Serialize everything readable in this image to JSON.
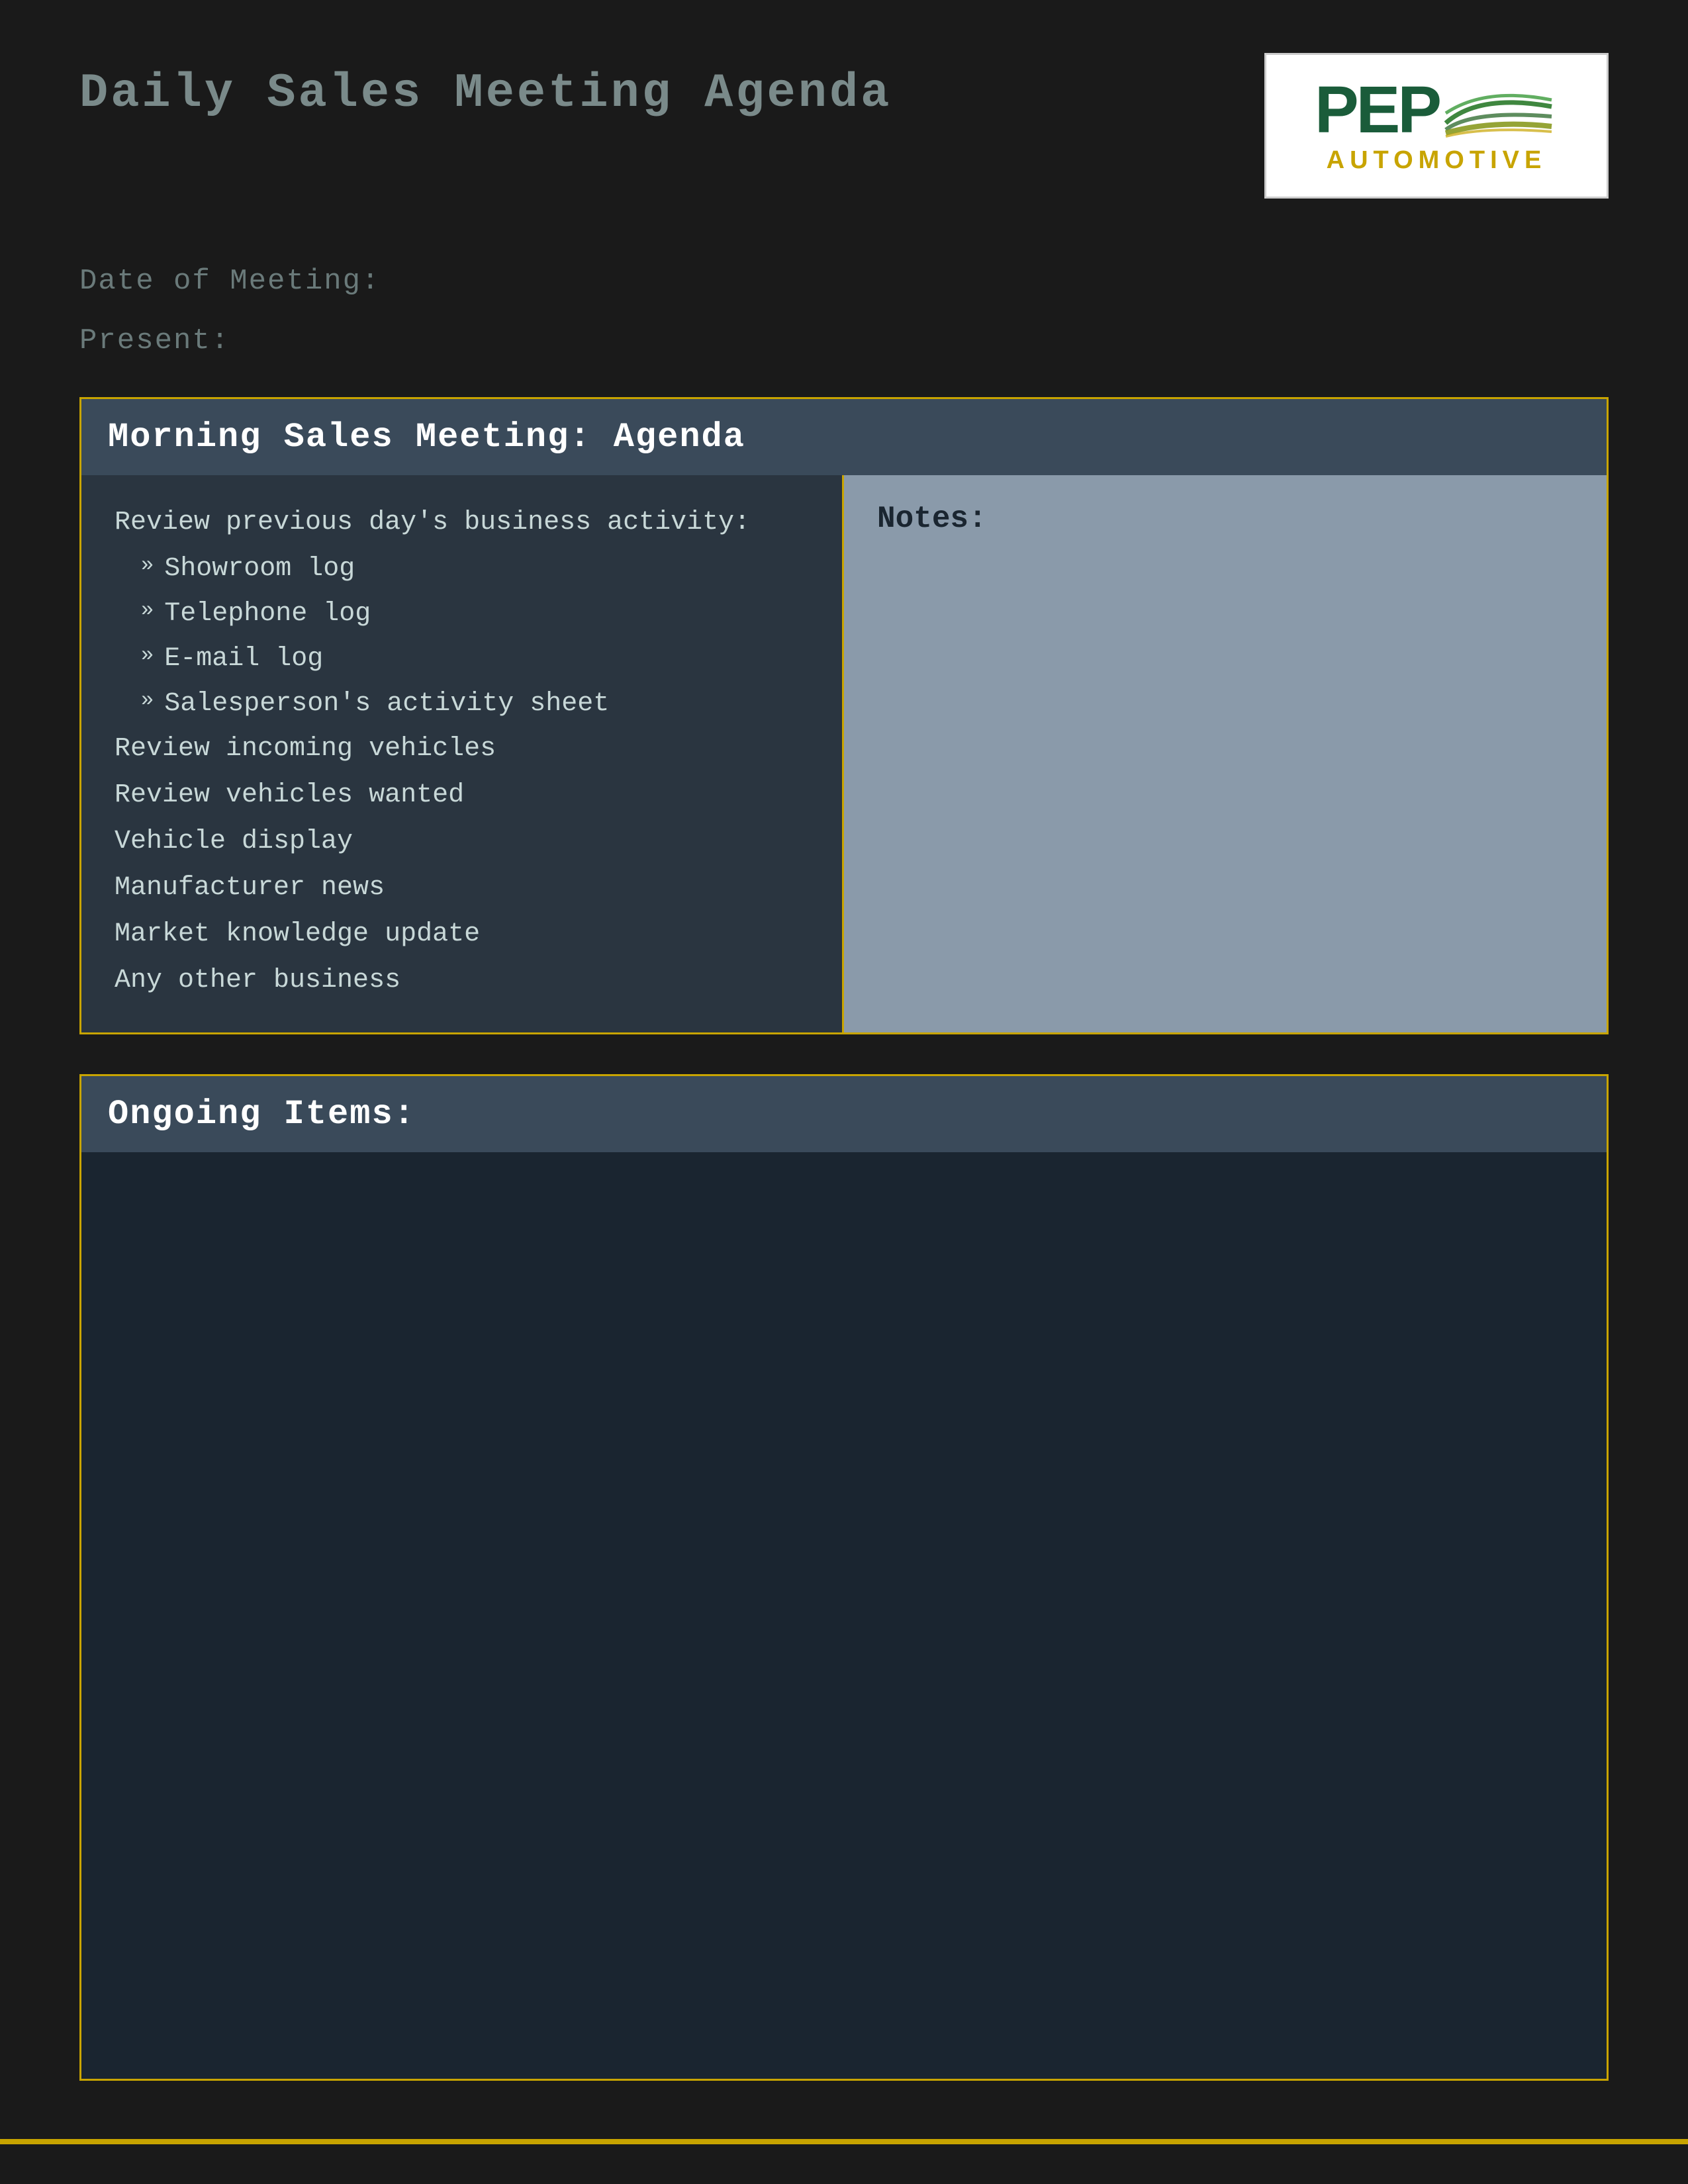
{
  "page": {
    "title": "Daily Sales Meeting Agenda",
    "background_color": "#1a1a1a"
  },
  "logo": {
    "brand": "PEP",
    "subtitle": "AUTOMOTIVE",
    "brand_color": "#1a5c3a",
    "subtitle_color": "#c8a400"
  },
  "meta": {
    "date_label": "Date of Meeting:",
    "present_label": "Present:"
  },
  "morning_section": {
    "header": "Morning Sales Meeting: Agenda",
    "review_heading": "Review previous day's business activity:",
    "sub_items": [
      "Showroom log",
      "Telephone log",
      "E-mail log",
      "Salesperson's activity sheet"
    ],
    "plain_items": [
      "Review incoming vehicles",
      "Review vehicles wanted",
      "Vehicle display",
      "Manufacturer news",
      "Market knowledge update",
      "Any other business"
    ],
    "notes_label": "Notes:"
  },
  "ongoing_section": {
    "header": "Ongoing Items:"
  }
}
